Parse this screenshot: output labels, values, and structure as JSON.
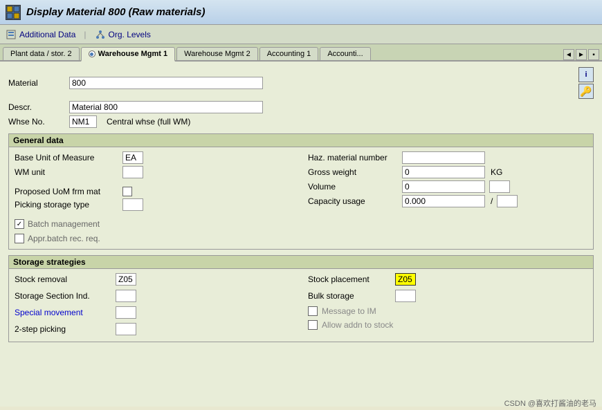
{
  "title_bar": {
    "icon_text": "M",
    "title": "Display Material 800 (Raw materials)"
  },
  "toolbar": {
    "additional_data_label": "Additional Data",
    "org_levels_label": "Org. Levels"
  },
  "tabs": [
    {
      "label": "Plant data / stor. 2",
      "active": false,
      "has_radio": false
    },
    {
      "label": "Warehouse Mgmt 1",
      "active": true,
      "has_radio": true
    },
    {
      "label": "Warehouse Mgmt 2",
      "active": false,
      "has_radio": false
    },
    {
      "label": "Accounting 1",
      "active": false,
      "has_radio": false
    },
    {
      "label": "Accounti...",
      "active": false,
      "has_radio": false
    }
  ],
  "header": {
    "material_label": "Material",
    "material_value": "800",
    "descr_label": "Descr.",
    "descr_value": "Material 800",
    "whse_label": "Whse No.",
    "whse_value": "NM1",
    "whse_desc": "Central whse (full WM)"
  },
  "general_data": {
    "section_title": "General data",
    "base_uom_label": "Base Unit of Measure",
    "base_uom_value": "EA",
    "wm_unit_label": "WM unit",
    "wm_unit_value": "",
    "proposed_uom_label": "Proposed UoM frm mat",
    "picking_storage_label": "Picking storage type",
    "batch_mgmt_label": "Batch management",
    "appr_batch_label": "Appr.batch rec. req.",
    "haz_material_label": "Haz. material number",
    "haz_material_value": "",
    "gross_weight_label": "Gross weight",
    "gross_weight_value": "0",
    "gross_weight_unit": "KG",
    "volume_label": "Volume",
    "volume_value": "0",
    "volume_unit": "",
    "capacity_usage_label": "Capacity usage",
    "capacity_value": "0.000",
    "capacity_slash": "/",
    "capacity_unit": ""
  },
  "storage_strategies": {
    "section_title": "Storage strategies",
    "stock_removal_label": "Stock removal",
    "stock_removal_value": "Z05",
    "storage_section_label": "Storage Section Ind.",
    "storage_section_value": "",
    "special_movement_label": "Special movement",
    "special_movement_value": "",
    "two_step_label": "2-step picking",
    "two_step_value": "",
    "stock_placement_label": "Stock placement",
    "stock_placement_value": "Z05",
    "bulk_storage_label": "Bulk storage",
    "bulk_storage_value": "",
    "message_to_label": "Message to IM",
    "allow_addn_label": "Allow addn to stock"
  },
  "watermark": "CSDN @喜欢打酱油的老马"
}
